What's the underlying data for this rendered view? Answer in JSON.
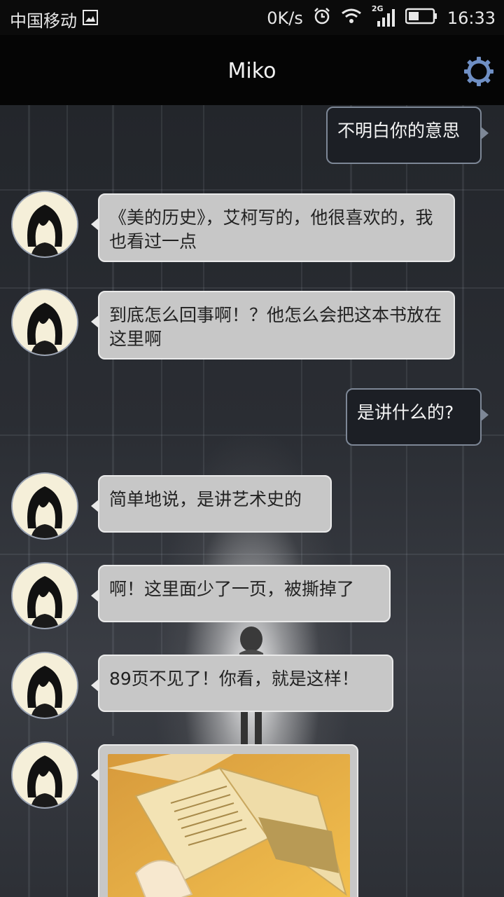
{
  "status": {
    "carrier": "中国移动",
    "speed": "0K/s",
    "network": "2G",
    "time": "16:33"
  },
  "header": {
    "title": "Miko"
  },
  "messages": [
    {
      "from": "me",
      "text": "不明白你的意思"
    },
    {
      "from": "miko",
      "text": "《美的历史》，艾柯写的，他很喜欢的，我也看过一点"
    },
    {
      "from": "miko",
      "text": "到底怎么回事啊！？他怎么会把这本书放在这里啊"
    },
    {
      "from": "me",
      "text": "是讲什么的?"
    },
    {
      "from": "miko",
      "text": "简单地说，是讲艺术史的"
    },
    {
      "from": "miko",
      "text": "啊！这里面少了一页，被撕掉了"
    },
    {
      "from": "miko",
      "text": "89页不见了！你看，就是这样！"
    },
    {
      "from": "miko",
      "type": "image"
    }
  ],
  "colors": {
    "incoming_bubble": "#c7c7c7",
    "outgoing_bubble": "#1c1f25",
    "gear": "#6f8fc4"
  }
}
